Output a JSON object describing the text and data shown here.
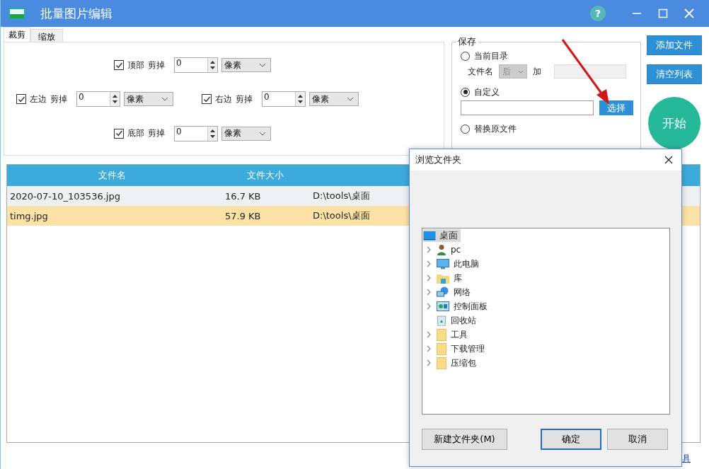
{
  "window": {
    "title": "批量图片编辑",
    "help": "?"
  },
  "tabs": [
    {
      "label": "裁剪",
      "selected": true
    },
    {
      "label": "缩放",
      "selected": false
    }
  ],
  "crop_rows": [
    {
      "kind": "top",
      "label": "顶部",
      "action": "剪掉",
      "checked": true,
      "value": "0",
      "unit": "像素"
    },
    {
      "kind": "left",
      "label": "左边",
      "action": "剪掉",
      "checked": true,
      "value": "0",
      "unit": "像素"
    },
    {
      "kind": "right",
      "label": "右边",
      "action": "剪掉",
      "checked": true,
      "value": "0",
      "unit": "像素"
    },
    {
      "kind": "bottom",
      "label": "底部",
      "action": "剪掉",
      "checked": true,
      "value": "0",
      "unit": "像素"
    }
  ],
  "save": {
    "title": "保存",
    "options": [
      {
        "label": "当前目录",
        "selected": false
      },
      {
        "label": "自定义",
        "selected": true
      },
      {
        "label": "替换原文件",
        "selected": false
      }
    ],
    "filename_label": "文件名",
    "position_select": "后",
    "add_label": "加",
    "choose_button": "选择"
  },
  "buttons": {
    "add_files": "添加文件",
    "clear_list": "清空列表",
    "start": "开始"
  },
  "table": {
    "columns": [
      "文件名",
      "文件大小"
    ],
    "rows": [
      {
        "name": "2020-07-10_103536.jpg",
        "size": "16.7 KB",
        "path": "D:\\tools\\桌面",
        "selected": false
      },
      {
        "name": "timg.jpg",
        "size": "57.9 KB",
        "path": "D:\\tools\\桌面",
        "selected": true
      }
    ]
  },
  "link": "具",
  "dialog": {
    "title": "浏览文件夹",
    "tree": {
      "label": "桌面",
      "selected": true,
      "children": [
        {
          "label": "pc",
          "kind": "user",
          "expandable": true
        },
        {
          "label": "此电脑",
          "kind": "computer",
          "expandable": true
        },
        {
          "label": "库",
          "kind": "library",
          "expandable": true
        },
        {
          "label": "网络",
          "kind": "network",
          "expandable": true
        },
        {
          "label": "控制面板",
          "kind": "control-panel",
          "expandable": true
        },
        {
          "label": "回收站",
          "kind": "recycle-bin",
          "expandable": false
        },
        {
          "label": "工具",
          "kind": "folder",
          "expandable": true
        },
        {
          "label": "下载管理",
          "kind": "folder",
          "expandable": true
        },
        {
          "label": "压缩包",
          "kind": "folder",
          "expandable": true
        }
      ]
    },
    "buttons": [
      {
        "label": "新建文件夹(M)",
        "kind": "new"
      },
      {
        "label": "确定",
        "kind": "ok"
      },
      {
        "label": "取消",
        "kind": "cancel"
      }
    ]
  }
}
